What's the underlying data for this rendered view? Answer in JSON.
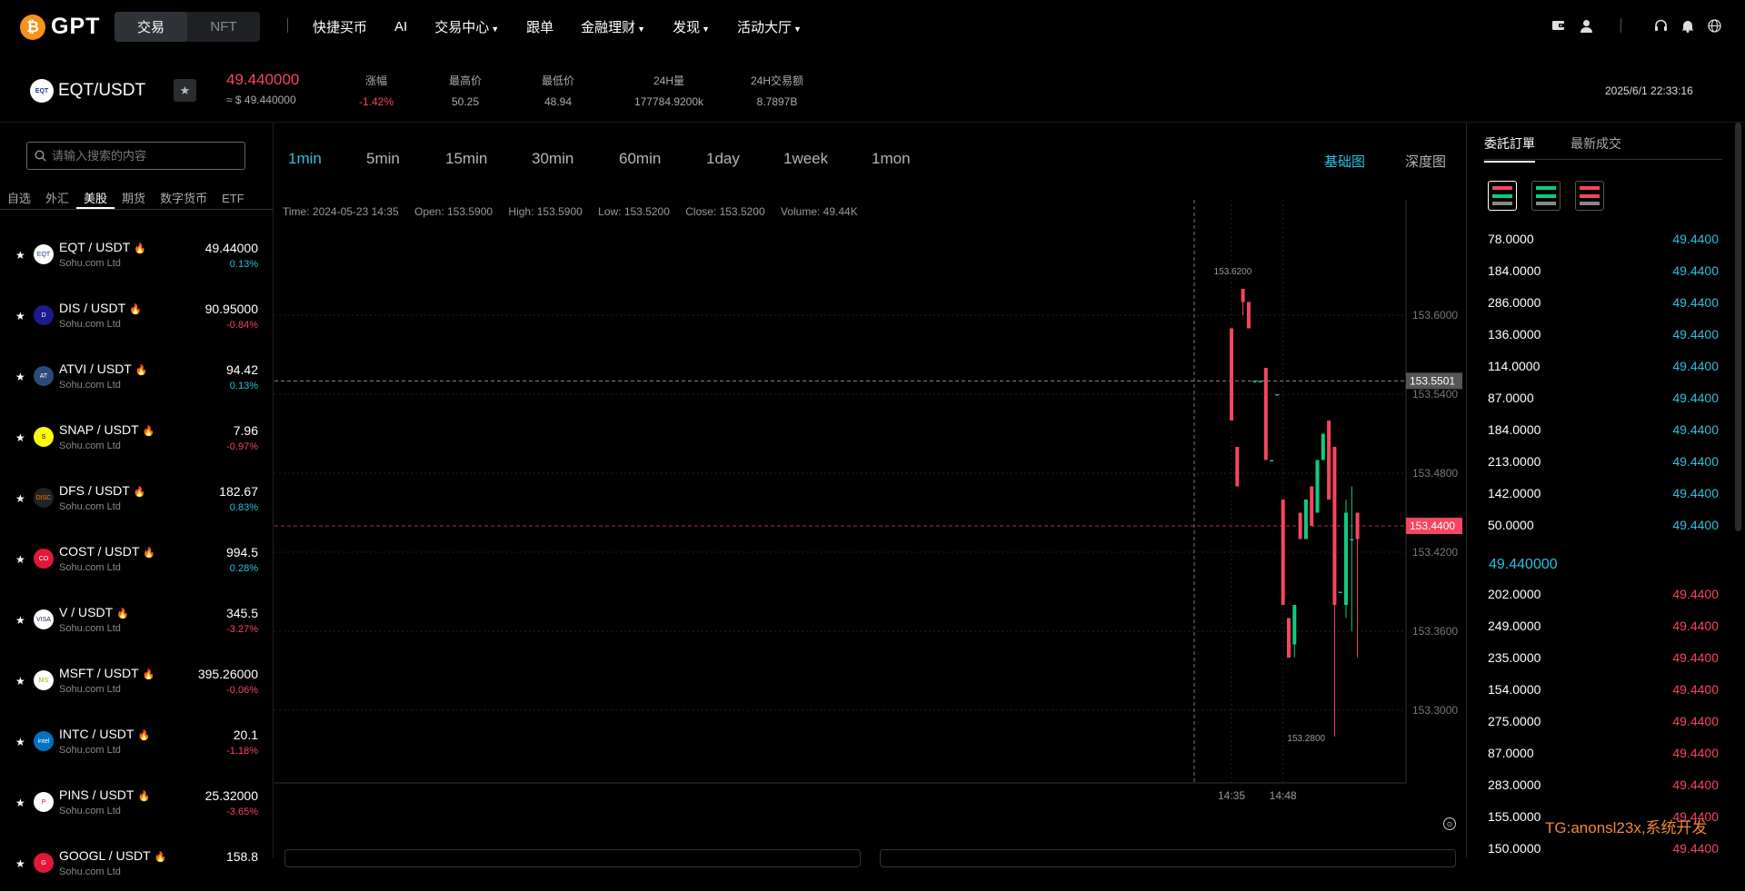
{
  "brand": {
    "name": "GPT",
    "coin": "₿"
  },
  "seg": [
    "交易",
    "NFT"
  ],
  "nav": [
    {
      "label": "快捷买币",
      "caret": false
    },
    {
      "label": "AI",
      "caret": false
    },
    {
      "label": "交易中心",
      "caret": true
    },
    {
      "label": "跟单",
      "caret": false
    },
    {
      "label": "金融理财",
      "caret": true
    },
    {
      "label": "发现",
      "caret": true
    },
    {
      "label": "活动大厅",
      "caret": true
    }
  ],
  "ticker": {
    "logo": "EQT",
    "pair": "EQT/USDT",
    "price": "49.440000",
    "usd": "≈ $ 49.440000",
    "stats": [
      {
        "label": "涨幅",
        "value": "-1.42%",
        "color": "#f6465d"
      },
      {
        "label": "最高价",
        "value": "50.25",
        "color": "#aaaaaa"
      },
      {
        "label": "最低价",
        "value": "48.94",
        "color": "#aaaaaa"
      },
      {
        "label": "24H量",
        "value": "177784.9200k",
        "color": "#aaaaaa"
      },
      {
        "label": "24H交易额",
        "value": "8.7897B",
        "color": "#aaaaaa"
      }
    ],
    "datetime": "2025/6/1 22:33:16"
  },
  "search": {
    "placeholder": "请输入搜索的内容"
  },
  "market_tabs": [
    {
      "label": "自选",
      "active": false
    },
    {
      "label": "外汇",
      "active": false
    },
    {
      "label": "美股",
      "active": true
    },
    {
      "label": "期货",
      "active": false
    },
    {
      "label": "数字货币",
      "active": false
    },
    {
      "label": "ETF",
      "active": false
    }
  ],
  "markets": [
    {
      "logo": "EQT",
      "logo_bg": "#ffffff",
      "logo_fg": "#1a3d8f",
      "name": "EQT / USDT",
      "sub": "Sohu.com Ltd",
      "price": "49.44000",
      "change": "0.13%",
      "up": true
    },
    {
      "logo": "D",
      "logo_bg": "#1b1b8f",
      "logo_fg": "#ffffff",
      "name": "DIS / USDT",
      "sub": "Sohu.com Ltd",
      "price": "90.95000",
      "change": "-0.84%",
      "up": false
    },
    {
      "logo": "AT",
      "logo_bg": "#2a4a7a",
      "logo_fg": "#ffffff",
      "name": "ATVI / USDT",
      "sub": "Sohu.com Ltd",
      "price": "94.42",
      "change": "0.13%",
      "up": true
    },
    {
      "logo": "S",
      "logo_bg": "#fffc00",
      "logo_fg": "#000000",
      "name": "SNAP / USDT",
      "sub": "Sohu.com Ltd",
      "price": "7.96",
      "change": "-0.97%",
      "up": false
    },
    {
      "logo": "DISC",
      "logo_bg": "#222222",
      "logo_fg": "#ff7a00",
      "name": "DFS / USDT",
      "sub": "Sohu.com Ltd",
      "price": "182.67",
      "change": "0.83%",
      "up": true
    },
    {
      "logo": "CO",
      "logo_bg": "#e31837",
      "logo_fg": "#ffffff",
      "name": "COST / USDT",
      "sub": "Sohu.com Ltd",
      "price": "994.5",
      "change": "0.28%",
      "up": true
    },
    {
      "logo": "VISA",
      "logo_bg": "#ffffff",
      "logo_fg": "#1a1f71",
      "name": "V / USDT",
      "sub": "Sohu.com Ltd",
      "price": "345.5",
      "change": "-3.27%",
      "up": false
    },
    {
      "logo": "MS",
      "logo_bg": "#ffffff",
      "logo_fg": "#7fba00",
      "name": "MSFT / USDT",
      "sub": "Sohu.com Ltd",
      "price": "395.26000",
      "change": "-0.06%",
      "up": false
    },
    {
      "logo": "intel",
      "logo_bg": "#0071c5",
      "logo_fg": "#ffffff",
      "name": "INTC / USDT",
      "sub": "Sohu.com Ltd",
      "price": "20.1",
      "change": "-1.18%",
      "up": false
    },
    {
      "logo": "P",
      "logo_bg": "#ffffff",
      "logo_fg": "#e60023",
      "name": "PINS / USDT",
      "sub": "Sohu.com Ltd",
      "price": "25.32000",
      "change": "-3.65%",
      "up": false
    },
    {
      "logo": "G",
      "logo_bg": "#e31837",
      "logo_fg": "#ffffff",
      "name": "GOOGL / USDT",
      "sub": "Sohu.com Ltd",
      "price": "158.8",
      "change": "",
      "up": true
    }
  ],
  "timeframes": [
    {
      "label": "1min",
      "active": true
    },
    {
      "label": "5min",
      "active": false
    },
    {
      "label": "15min",
      "active": false
    },
    {
      "label": "30min",
      "active": false
    },
    {
      "label": "60min",
      "active": false
    },
    {
      "label": "1day",
      "active": false
    },
    {
      "label": "1week",
      "active": false
    },
    {
      "label": "1mon",
      "active": false
    }
  ],
  "chart_views": [
    {
      "label": "基础图",
      "active": true
    },
    {
      "label": "深度图",
      "active": false
    }
  ],
  "chart_info": {
    "time": "Time: 2024-05-23 14:35",
    "open": "Open: 153.5900",
    "high": "High: 153.5900",
    "low": "Low: 153.5200",
    "close": "Close: 153.5200",
    "volume": "Volume: 49.44K"
  },
  "chart_data": {
    "type": "candlestick",
    "y_ticks": [
      153.3,
      153.36,
      153.42,
      153.48,
      153.54,
      153.6
    ],
    "y_tick_labels": [
      "153.3000",
      "153.3600",
      "153.4200",
      "153.4800",
      "153.5400",
      "153.6000"
    ],
    "x_ticks": [
      {
        "index": 0,
        "label": "14:35"
      },
      {
        "index": 9,
        "label": "14:48"
      }
    ],
    "crosshair": 153.5501,
    "crosshair_label": "153.5501",
    "last_price": 153.44,
    "last_price_label": "153.4400",
    "max_label": "153.6200",
    "min_label": "153.2800",
    "candles": [
      {
        "o": 153.59,
        "c": 153.52,
        "h": 153.59,
        "l": 153.52
      },
      {
        "o": 153.5,
        "c": 153.47,
        "h": 153.5,
        "l": 153.47
      },
      {
        "o": 153.62,
        "c": 153.61,
        "h": 153.62,
        "l": 153.6
      },
      {
        "o": 153.61,
        "c": 153.59,
        "h": 153.61,
        "l": 153.59
      },
      {
        "o": 153.55,
        "c": 153.55,
        "h": 153.55,
        "l": 153.55
      },
      {
        "o": 153.55,
        "c": 153.55,
        "h": 153.55,
        "l": 153.55
      },
      {
        "o": 153.56,
        "c": 153.49,
        "h": 153.56,
        "l": 153.49
      },
      {
        "o": 153.49,
        "c": 153.49,
        "h": 153.49,
        "l": 153.49
      },
      {
        "o": 153.54,
        "c": 153.54,
        "h": 153.54,
        "l": 153.54
      },
      {
        "o": 153.46,
        "c": 153.38,
        "h": 153.46,
        "l": 153.38
      },
      {
        "o": 153.37,
        "c": 153.34,
        "h": 153.37,
        "l": 153.34
      },
      {
        "o": 153.35,
        "c": 153.38,
        "h": 153.38,
        "l": 153.34
      },
      {
        "o": 153.45,
        "c": 153.43,
        "h": 153.45,
        "l": 153.43
      },
      {
        "o": 153.43,
        "c": 153.46,
        "h": 153.46,
        "l": 153.43
      },
      {
        "o": 153.47,
        "c": 153.44,
        "h": 153.47,
        "l": 153.44
      },
      {
        "o": 153.45,
        "c": 153.49,
        "h": 153.49,
        "l": 153.45
      },
      {
        "o": 153.49,
        "c": 153.51,
        "h": 153.51,
        "l": 153.49
      },
      {
        "o": 153.52,
        "c": 153.46,
        "h": 153.52,
        "l": 153.46
      },
      {
        "o": 153.5,
        "c": 153.38,
        "h": 153.5,
        "l": 153.28
      },
      {
        "o": 153.39,
        "c": 153.39,
        "h": 153.39,
        "l": 153.39
      },
      {
        "o": 153.38,
        "c": 153.45,
        "h": 153.46,
        "l": 153.37
      },
      {
        "o": 153.43,
        "c": 153.43,
        "h": 153.47,
        "l": 153.36
      },
      {
        "o": 153.45,
        "c": 153.43,
        "h": 153.45,
        "l": 153.34
      }
    ]
  },
  "order_tabs": [
    {
      "label": "委託訂單",
      "active": true
    },
    {
      "label": "最新成交",
      "active": false
    }
  ],
  "order_book": {
    "asks": [
      {
        "amount": "78.0000",
        "price": "49.4400"
      },
      {
        "amount": "184.0000",
        "price": "49.4400"
      },
      {
        "amount": "286.0000",
        "price": "49.4400"
      },
      {
        "amount": "136.0000",
        "price": "49.4400"
      },
      {
        "amount": "114.0000",
        "price": "49.4400"
      },
      {
        "amount": "87.0000",
        "price": "49.4400"
      },
      {
        "amount": "184.0000",
        "price": "49.4400"
      },
      {
        "amount": "213.0000",
        "price": "49.4400"
      },
      {
        "amount": "142.0000",
        "price": "49.4400"
      },
      {
        "amount": "50.0000",
        "price": "49.4400"
      }
    ],
    "mid": "49.440000",
    "bids": [
      {
        "amount": "202.0000",
        "price": "49.4400"
      },
      {
        "amount": "249.0000",
        "price": "49.4400"
      },
      {
        "amount": "235.0000",
        "price": "49.4400"
      },
      {
        "amount": "154.0000",
        "price": "49.4400"
      },
      {
        "amount": "275.0000",
        "price": "49.4400"
      },
      {
        "amount": "87.0000",
        "price": "49.4400"
      },
      {
        "amount": "283.0000",
        "price": "49.4400"
      },
      {
        "amount": "155.0000",
        "price": "49.4400"
      },
      {
        "amount": "150.0000",
        "price": "49.4400"
      }
    ]
  },
  "watermark": "TG:anonsl23x,系统开发",
  "colors": {
    "up": "#2ebfdf",
    "down": "#f6465d",
    "candle_up": "#0ecb81",
    "candle_down": "#f6465d",
    "accent": "#2ebfdf"
  }
}
